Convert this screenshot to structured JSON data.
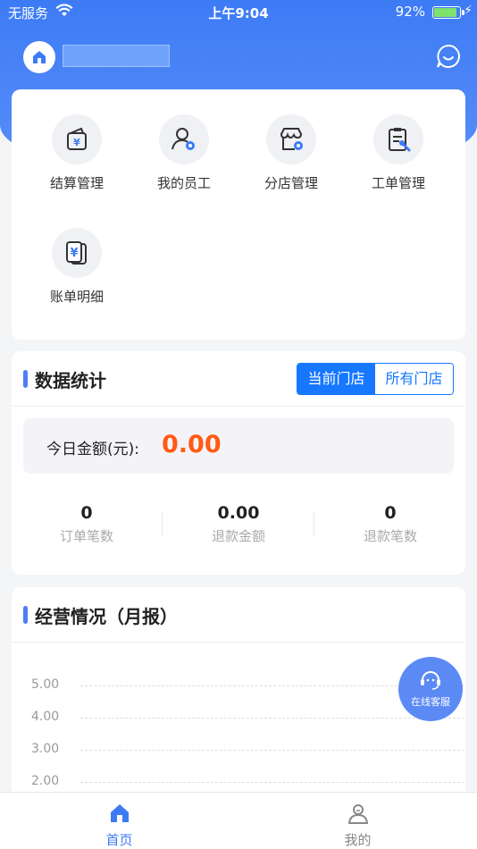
{
  "status_bar": {
    "carrier": "无服务",
    "time": "上午9:04",
    "battery": "92%",
    "battery_level": 0.92
  },
  "header": {
    "home_icon": "store-home-icon",
    "chat_icon": "chat-bubble-icon"
  },
  "menu": {
    "items": [
      {
        "label": "结算管理",
        "icon": "wallet-yuan-icon"
      },
      {
        "label": "我的员工",
        "icon": "staff-gear-icon"
      },
      {
        "label": "分店管理",
        "icon": "shop-gear-icon"
      },
      {
        "label": "工单管理",
        "icon": "clipboard-wrench-icon"
      },
      {
        "label": "账单明细",
        "icon": "bill-yuan-icon"
      }
    ]
  },
  "stats": {
    "title": "数据统计",
    "segments": [
      "当前门店",
      "所有门店"
    ],
    "selected_segment": "当前门店",
    "today_label": "今日金额(元):",
    "today_value": "0.00",
    "items": [
      {
        "value": "0",
        "label": "订单笔数"
      },
      {
        "value": "0.00",
        "label": "退款金额"
      },
      {
        "value": "0",
        "label": "退款笔数"
      }
    ]
  },
  "operations": {
    "title": "经营情况（月报）"
  },
  "chart_data": {
    "type": "line",
    "title": "",
    "xlabel": "",
    "ylabel": "",
    "y_ticks": [
      "5.00",
      "4.00",
      "3.00",
      "2.00"
    ],
    "series": []
  },
  "service": {
    "label": "在线客服",
    "icon": "headset-icon"
  },
  "tabbar": {
    "items": [
      {
        "label": "首页",
        "icon": "home-icon",
        "active": true
      },
      {
        "label": "我的",
        "icon": "user-icon",
        "active": false
      }
    ]
  },
  "colors": {
    "primary": "#3d7bf5",
    "accent_orange": "#ff5a14",
    "segment_blue": "#1677ff"
  }
}
